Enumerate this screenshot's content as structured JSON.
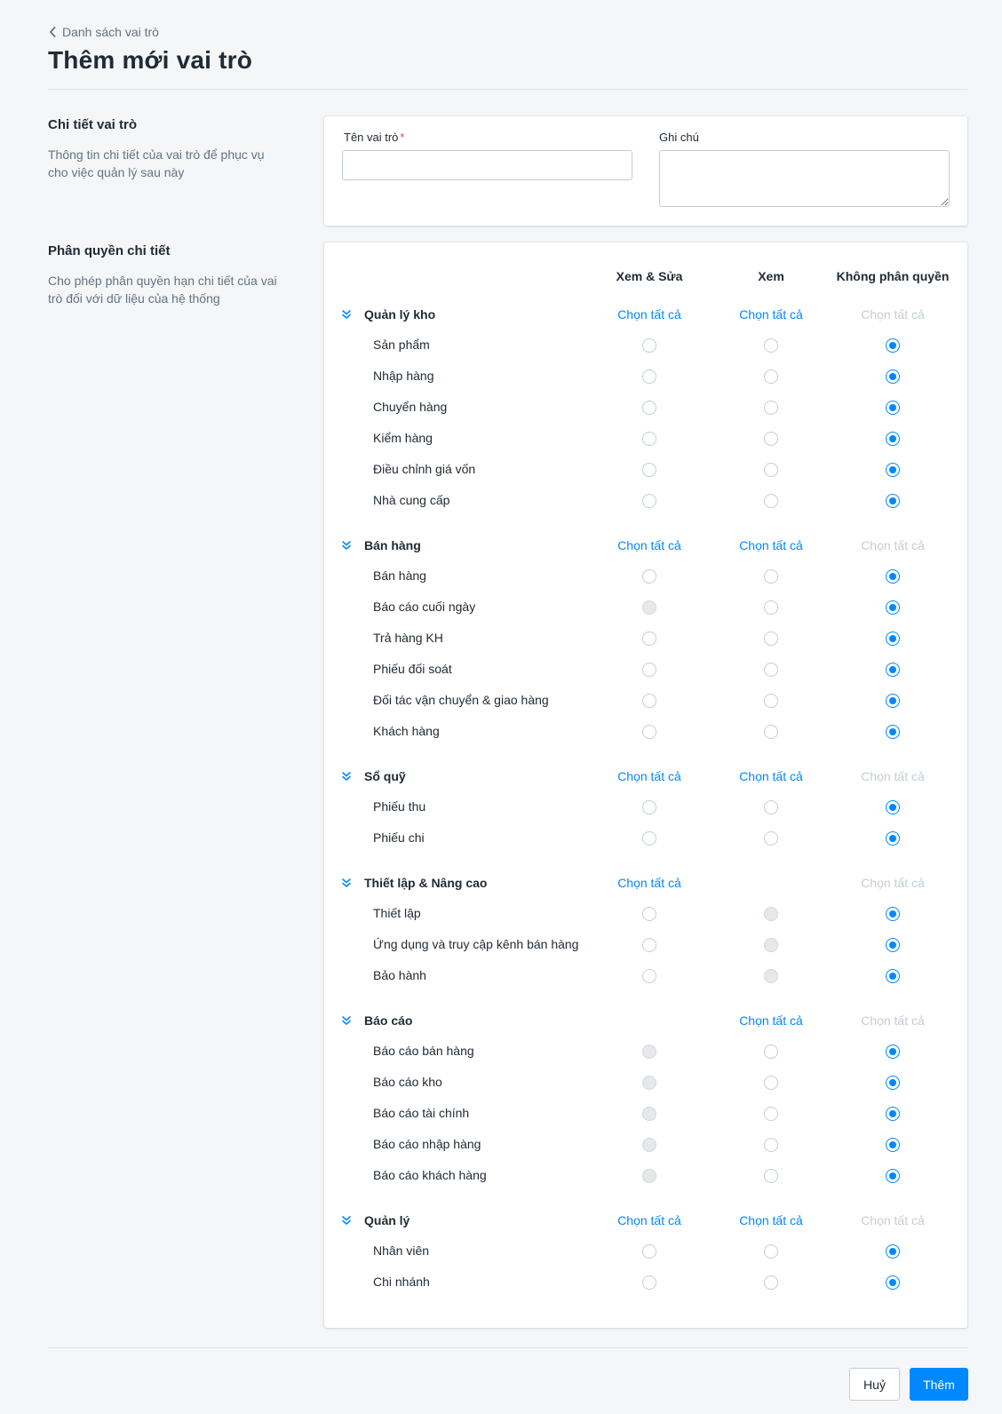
{
  "breadcrumb": {
    "label": "Danh sách vai trò"
  },
  "page_title": "Thêm mới vai trò",
  "role_details": {
    "title": "Chi tiết vai trò",
    "description": "Thông tin chi tiết của vai trò để phục vụ cho việc quản lý sau này",
    "name_label": "Tên vai trò",
    "required_mark": "*",
    "name_value": "",
    "note_label": "Ghi chú",
    "note_value": ""
  },
  "permissions": {
    "title": "Phân quyền chi tiết",
    "description": "Cho phép phân quyền hạn chi tiết của vai trò đối với dữ liệu của hệ thống",
    "columns": [
      "Xem & Sửa",
      "Xem",
      "Không phân quyền"
    ],
    "select_all_label": "Chọn tất cả",
    "groups": [
      {
        "name": "Quản lý kho",
        "select_all": [
          true,
          true,
          false
        ],
        "items": [
          {
            "name": "Sản phẩm",
            "state": [
              "off",
              "off",
              "on"
            ]
          },
          {
            "name": "Nhập hàng",
            "state": [
              "off",
              "off",
              "on"
            ]
          },
          {
            "name": "Chuyển hàng",
            "state": [
              "off",
              "off",
              "on"
            ]
          },
          {
            "name": "Kiểm hàng",
            "state": [
              "off",
              "off",
              "on"
            ]
          },
          {
            "name": "Điều chỉnh giá vốn",
            "state": [
              "off",
              "off",
              "on"
            ]
          },
          {
            "name": "Nhà cung cấp",
            "state": [
              "off",
              "off",
              "on"
            ]
          }
        ]
      },
      {
        "name": "Bán hàng",
        "select_all": [
          true,
          true,
          false
        ],
        "items": [
          {
            "name": "Bán hàng",
            "state": [
              "off",
              "off",
              "on"
            ]
          },
          {
            "name": "Báo cáo cuối ngày",
            "state": [
              "disabled",
              "off",
              "on"
            ]
          },
          {
            "name": "Trả hàng KH",
            "state": [
              "off",
              "off",
              "on"
            ]
          },
          {
            "name": "Phiếu đối soát",
            "state": [
              "off",
              "off",
              "on"
            ]
          },
          {
            "name": "Đối tác vận chuyển & giao hàng",
            "state": [
              "off",
              "off",
              "on"
            ]
          },
          {
            "name": "Khách hàng",
            "state": [
              "off",
              "off",
              "on"
            ]
          }
        ]
      },
      {
        "name": "Sổ quỹ",
        "select_all": [
          true,
          true,
          false
        ],
        "items": [
          {
            "name": "Phiếu thu",
            "state": [
              "off",
              "off",
              "on"
            ]
          },
          {
            "name": "Phiếu chi",
            "state": [
              "off",
              "off",
              "on"
            ]
          }
        ]
      },
      {
        "name": "Thiết lập & Nâng cao",
        "select_all": [
          true,
          null,
          false
        ],
        "items": [
          {
            "name": "Thiết lập",
            "state": [
              "off",
              "disabled",
              "on"
            ]
          },
          {
            "name": "Ứng dụng và truy cập kênh bán hàng",
            "state": [
              "off",
              "disabled",
              "on"
            ]
          },
          {
            "name": "Bảo hành",
            "state": [
              "off",
              "disabled",
              "on"
            ]
          }
        ]
      },
      {
        "name": "Báo cáo",
        "select_all": [
          null,
          true,
          false
        ],
        "items": [
          {
            "name": "Báo cáo bán hàng",
            "state": [
              "disabled",
              "off",
              "on"
            ]
          },
          {
            "name": "Báo cáo kho",
            "state": [
              "disabled",
              "off",
              "on"
            ]
          },
          {
            "name": "Báo cáo tài chính",
            "state": [
              "disabled",
              "off",
              "on"
            ]
          },
          {
            "name": "Báo cáo nhập hàng",
            "state": [
              "disabled",
              "off",
              "on"
            ]
          },
          {
            "name": "Báo cáo khách hàng",
            "state": [
              "disabled",
              "off",
              "on"
            ]
          }
        ]
      },
      {
        "name": "Quản lý",
        "select_all": [
          true,
          true,
          false
        ],
        "items": [
          {
            "name": "Nhân viên",
            "state": [
              "off",
              "off",
              "on"
            ]
          },
          {
            "name": "Chi nhánh",
            "state": [
              "off",
              "off",
              "on"
            ]
          }
        ]
      }
    ]
  },
  "footer": {
    "cancel_label": "Huỷ",
    "submit_label": "Thêm"
  },
  "colors": {
    "accent": "#0088ff",
    "muted_link": "#c4cdd5",
    "text": "#212b35",
    "subtext": "#637381"
  }
}
